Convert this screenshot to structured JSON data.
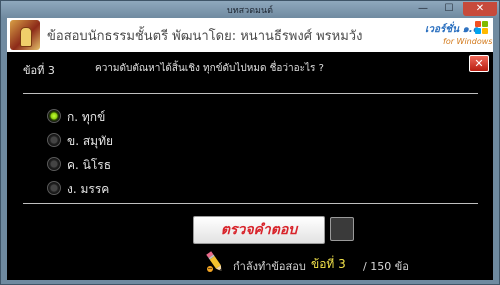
{
  "window": {
    "title": "บทสวดมนต์",
    "min_glyph": "—",
    "max_glyph": "☐",
    "close_glyph": "✕"
  },
  "header": {
    "title": "ข้อสอบนักธรรมชั้นตรี  พัฒนาโดย: หนานธีรพงศ์  พรหมวัง",
    "version": "เวอร์ชั่น ๑.๐",
    "version_sub": "for Windows",
    "logo_icon": "temple-logo-icon",
    "flag_icon": "windows-flag-icon"
  },
  "question": {
    "number_label": "ข้อที่   3",
    "text": "ความดับตัณหาได้สิ้นเชิง ทุกข์ดับไปหมด ชื่อว่าอะไร ?",
    "close_glyph": "✕"
  },
  "options": [
    {
      "label": "ก. ทุกข์",
      "selected": true
    },
    {
      "label": "ข. สมุทัย",
      "selected": false
    },
    {
      "label": "ค. นิโรธ",
      "selected": false
    },
    {
      "label": "ง. มรรค",
      "selected": false
    }
  ],
  "actions": {
    "check_label": "ตรวจคำตอบ"
  },
  "status": {
    "doing_label": "กำลังทำข้อสอบ",
    "current_label": "ข้อที่  3",
    "total_label": "/ 150 ข้อ",
    "pencil_icon": "pencil-icon"
  },
  "colors": {
    "accent_red": "#d8232a",
    "status_yellow": "#f2e24a",
    "radio_selected": "#8fd10f",
    "background": "#000000"
  }
}
